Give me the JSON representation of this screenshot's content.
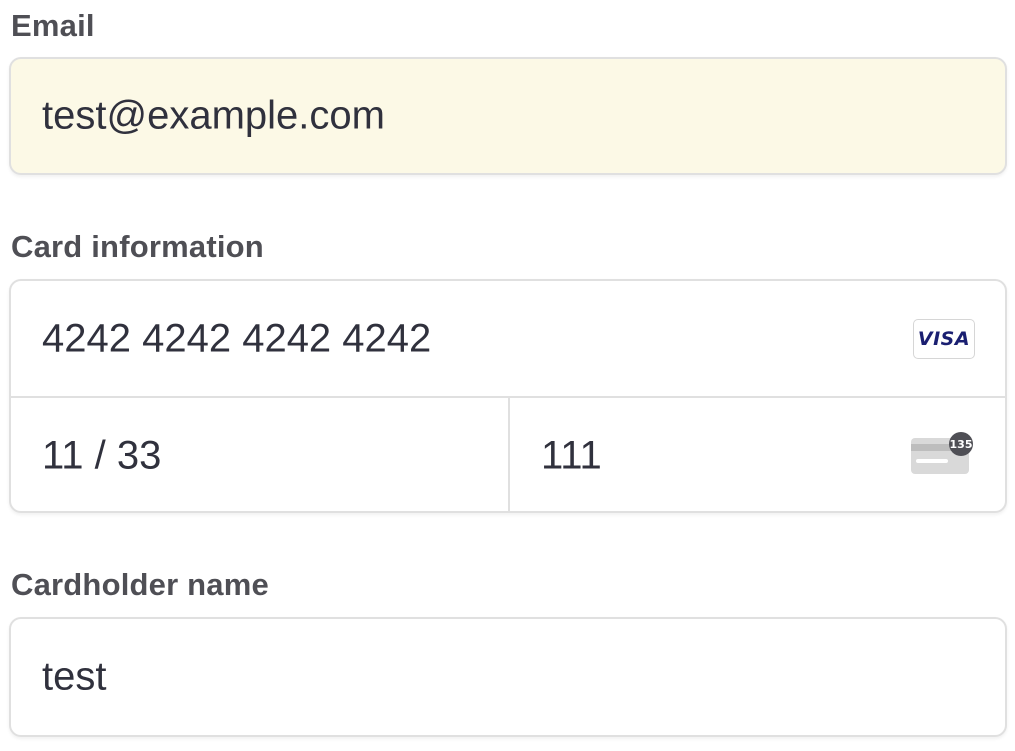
{
  "email": {
    "label": "Email",
    "value": "test@example.com"
  },
  "card": {
    "label": "Card information",
    "number": "4242 4242 4242 4242",
    "brand": "VISA",
    "expiry": "11 / 33",
    "cvc": "111",
    "cvc_hint": "135"
  },
  "cardholder": {
    "label": "Cardholder name",
    "value": "test"
  },
  "colors": {
    "autofill_bg": "#fcf9e6",
    "visa_blue": "#1a1f71",
    "border": "#e0e0e0",
    "label": "#4f4f55"
  }
}
